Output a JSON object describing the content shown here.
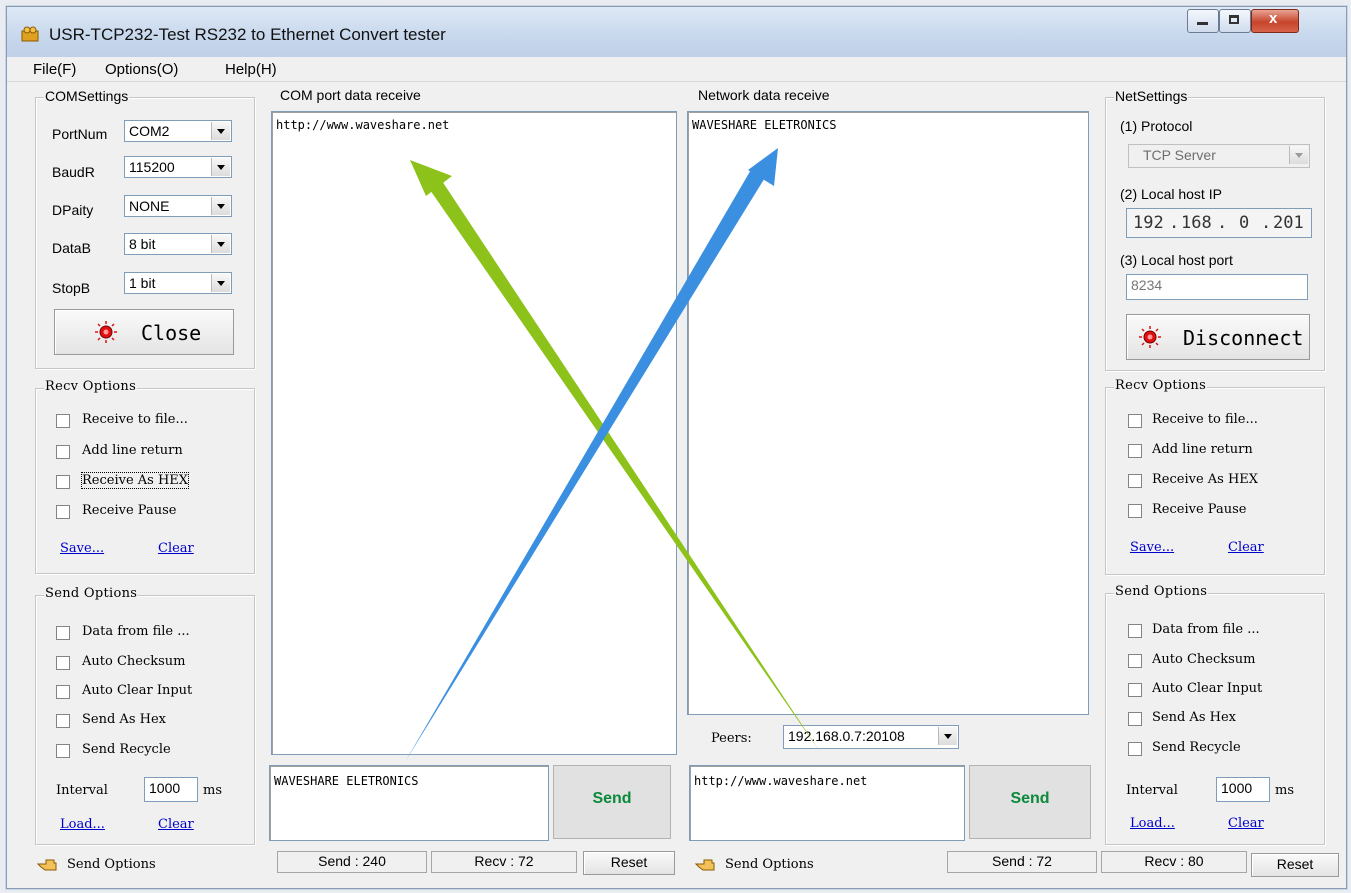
{
  "window": {
    "title": "USR-TCP232-Test  RS232 to Ethernet Convert tester",
    "close_glyph": "x"
  },
  "menu": [
    "File(F)",
    "Options(O)",
    "Help(H)"
  ],
  "com_settings": {
    "legend": "COMSettings",
    "rows": [
      {
        "label": "PortNum",
        "value": "COM2"
      },
      {
        "label": "BaudR",
        "value": "115200"
      },
      {
        "label": "DPaity",
        "value": "NONE"
      },
      {
        "label": "DataB",
        "value": "8 bit"
      },
      {
        "label": "StopB",
        "value": "1 bit"
      }
    ],
    "close_button": "Close"
  },
  "left_recv": {
    "legend": "Recv Options",
    "options": [
      "Receive to file...",
      "Add line return",
      "Receive As HEX",
      "Receive Pause"
    ],
    "save": "Save...",
    "clear": "Clear"
  },
  "left_send": {
    "legend": "Send Options",
    "options": [
      "Data from file ...",
      "Auto Checksum",
      "Auto Clear Input",
      "Send As Hex",
      "Send Recycle"
    ],
    "interval_label": "Interval",
    "interval_value": "1000",
    "interval_unit": "ms",
    "load": "Load...",
    "clear": "Clear"
  },
  "com_receive": {
    "legend": "COM port data receive",
    "content": "http://www.waveshare.net"
  },
  "net_receive": {
    "legend": "Network data receive",
    "content": "WAVESHARE ELETRONICS"
  },
  "peers": {
    "label": "Peers:",
    "value": "192.168.0.7:20108"
  },
  "com_send": {
    "content": "WAVESHARE ELETRONICS",
    "button": "Send"
  },
  "net_send": {
    "content": "http://www.waveshare.net",
    "button": "Send"
  },
  "net_settings": {
    "legend": "NetSettings",
    "protocol_label": "(1) Protocol",
    "protocol_value": "TCP Server",
    "ip_label": "(2) Local host IP",
    "ip_parts": [
      "192",
      "168",
      "0",
      "201"
    ],
    "port_label": "(3) Local host port",
    "port_value": "8234",
    "disconnect_button": "Disconnect"
  },
  "right_recv": {
    "legend": "Recv Options",
    "options": [
      "Receive to file...",
      "Add line return",
      "Receive As HEX",
      "Receive Pause"
    ],
    "save": "Save...",
    "clear": "Clear"
  },
  "right_send": {
    "legend": "Send Options",
    "options": [
      "Data from file ...",
      "Auto Checksum",
      "Auto Clear Input",
      "Send As Hex",
      "Send Recycle"
    ],
    "interval_label": "Interval",
    "interval_value": "1000",
    "interval_unit": "ms",
    "load": "Load...",
    "clear": "Clear"
  },
  "status_left": {
    "send_options": "Send Options",
    "send": "Send : 240",
    "recv": "Recv : 72",
    "reset": "Reset"
  },
  "status_right": {
    "send_options": "Send Options",
    "send": "Send : 72",
    "recv": "Recv : 80",
    "reset": "Reset"
  },
  "colors": {
    "send_text": "#0a8a3a",
    "link": "#0000cc",
    "arrow_green": "#8cc21a",
    "arrow_blue": "#3a8fe0",
    "close_button": "#c7452c"
  }
}
